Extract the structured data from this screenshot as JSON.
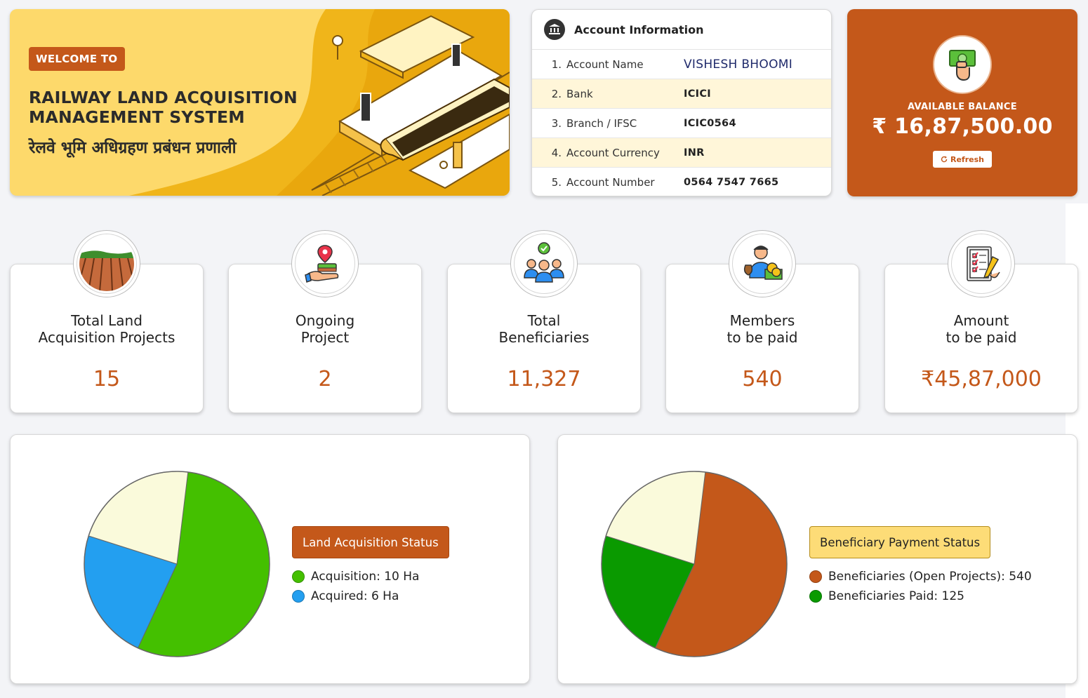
{
  "banner": {
    "tag": "WELCOME TO",
    "title": "RAILWAY LAND ACQUISITION MANAGEMENT SYSTEM",
    "title_hindi": "रेलवे भूमि अधिग्रहण प्रबंधन प्रणाली"
  },
  "account": {
    "title": "Account Information",
    "rows": [
      {
        "num": "1.",
        "label": "Account Name",
        "value": "VISHESH BHOOMI"
      },
      {
        "num": "2.",
        "label": "Bank",
        "value": "ICICI"
      },
      {
        "num": "3.",
        "label": "Branch / IFSC",
        "value": "ICIC0564"
      },
      {
        "num": "4.",
        "label": "Account Currency",
        "value": "INR"
      },
      {
        "num": "5.",
        "label": "Account Number",
        "value": "0564 7547 7665"
      }
    ]
  },
  "balance": {
    "label": "AVAILABLE BALANCE",
    "value": "₹ 16,87,500.00",
    "refresh_label": "Refresh"
  },
  "stats": [
    {
      "line1": "Total Land",
      "line2": "Acquisition Projects",
      "value": "15",
      "icon": "farmland-icon"
    },
    {
      "line1": "Ongoing",
      "line2": "Project",
      "value": "2",
      "icon": "land-location-icon"
    },
    {
      "line1": "Total",
      "line2": "Beneficiaries",
      "value": "11,327",
      "icon": "beneficiaries-icon"
    },
    {
      "line1": "Members",
      "line2": "to be paid",
      "value": "540",
      "icon": "member-money-icon"
    },
    {
      "line1": "Amount",
      "line2": "to be paid",
      "value": "₹45,87,000",
      "icon": "checklist-icon"
    }
  ],
  "charts": {
    "land": {
      "legend_title": "Land Acquisition Status",
      "items": [
        "Acquisition: 10 Ha",
        "Acquired: 6 Ha"
      ]
    },
    "beneficiary": {
      "legend_title": "Beneficiary Payment Status",
      "items": [
        "Beneficiaries (Open Projects): 540",
        "Beneficiaries Paid: 125"
      ]
    }
  },
  "colors": {
    "accent": "#c4581a",
    "green": "#44c000",
    "blue": "#239ff0",
    "cream": "#fafadb",
    "dark_green": "#0a9a00"
  },
  "chart_data": [
    {
      "type": "pie",
      "title": "Land Acquisition Status",
      "slices": [
        {
          "label": "Acquisition: 10 Ha",
          "value": 55,
          "color": "#44c000"
        },
        {
          "label": "Acquired: 6 Ha",
          "value": 23,
          "color": "#239ff0"
        },
        {
          "label": "",
          "value": 22,
          "color": "#fafadb"
        }
      ]
    },
    {
      "type": "pie",
      "title": "Beneficiary Payment Status",
      "slices": [
        {
          "label": "Beneficiaries (Open Projects): 540",
          "value": 55,
          "color": "#c4581a"
        },
        {
          "label": "Beneficiaries Paid: 125",
          "value": 23,
          "color": "#0a9a00"
        },
        {
          "label": "",
          "value": 22,
          "color": "#fafadb"
        }
      ]
    }
  ]
}
